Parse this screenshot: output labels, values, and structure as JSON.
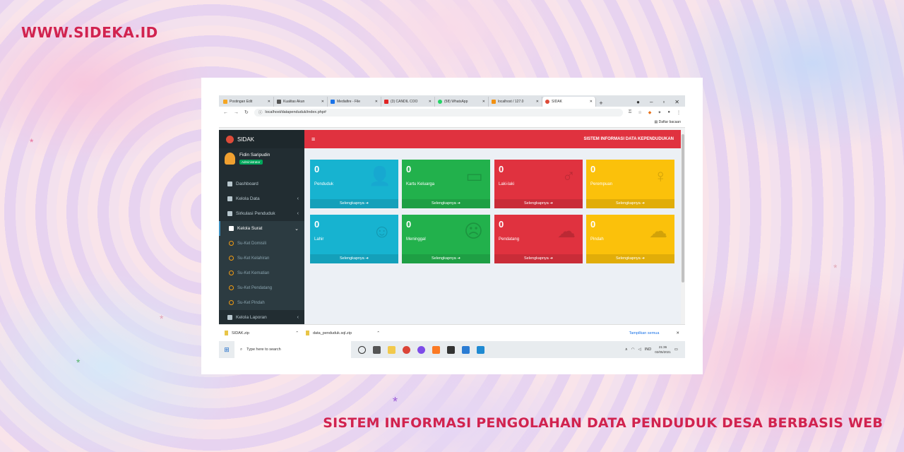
{
  "page": {
    "brand": "WWW.SIDEKA.ID",
    "caption": "SISTEM INFORMASI PENGOLAHAN DATA PENDUDUK DESA BERBASIS WEB"
  },
  "browser": {
    "tabs": [
      {
        "label": "Postingan Edit",
        "color": "#f5a623"
      },
      {
        "label": "Kualitas Akun",
        "color": "#555555"
      },
      {
        "label": "Mediafire - File",
        "color": "#1a73e8"
      },
      {
        "label": "(3) CANDIL COO",
        "color": "#e02424"
      },
      {
        "label": "(58) WhatsApp",
        "color": "#25d366"
      },
      {
        "label": "localhost / 127.0",
        "color": "#f29111"
      },
      {
        "label": "SIDAK",
        "color": "#dd4b39"
      }
    ],
    "new_tab": "+",
    "url": "localhost/datapenduduk/index.php#",
    "bookmark": "Daftar bacaan"
  },
  "app": {
    "logo": "SIDAK",
    "user_name": "Fidin Saripudin",
    "user_role": "Administrator",
    "header_title": "SISTEM INFORMASI DATA KEPENDUDUKAN",
    "menu": [
      {
        "label": "Dashboard",
        "arrow": ""
      },
      {
        "label": "Kelola Data",
        "arrow": "‹"
      },
      {
        "label": "Sirkulasi Penduduk",
        "arrow": "‹"
      },
      {
        "label": "Kelola Surat",
        "arrow": "⌄"
      }
    ],
    "submenu": [
      "Su-Ket Domisili",
      "Su-Ket Kelahiran",
      "Su-Ket Kematian",
      "Su-Ket Pendatang",
      "Su-Ket Pindah"
    ],
    "menu_last": {
      "label": "Kelola Laporan",
      "arrow": "‹"
    },
    "boxes": [
      {
        "value": "0",
        "label": "Penduduk",
        "icon": "👤",
        "color": "aqua"
      },
      {
        "value": "0",
        "label": "Kartu Keluarga",
        "icon": "▭",
        "color": "green"
      },
      {
        "value": "0",
        "label": "Laki-laki",
        "icon": "♂",
        "color": "red"
      },
      {
        "value": "0",
        "label": "Perempuan",
        "icon": "♀",
        "color": "yellow"
      },
      {
        "value": "0",
        "label": "Lahir",
        "icon": "☺",
        "color": "aqua"
      },
      {
        "value": "0",
        "label": "Meninggal",
        "icon": "☹",
        "color": "green"
      },
      {
        "value": "0",
        "label": "Pendatang",
        "icon": "☁",
        "color": "red"
      },
      {
        "value": "0",
        "label": "Pindah",
        "icon": "☁",
        "color": "yellow"
      }
    ],
    "more_label": "Selengkapnya ➔"
  },
  "downloads": {
    "items": [
      "SIDAK.zip",
      "data_penduduk.sql.zip"
    ],
    "show_all": "Tampilkan semua"
  },
  "taskbar": {
    "search_placeholder": "Type here to search",
    "lang": "IND",
    "time": "21:36",
    "date": "02/05/2021"
  }
}
